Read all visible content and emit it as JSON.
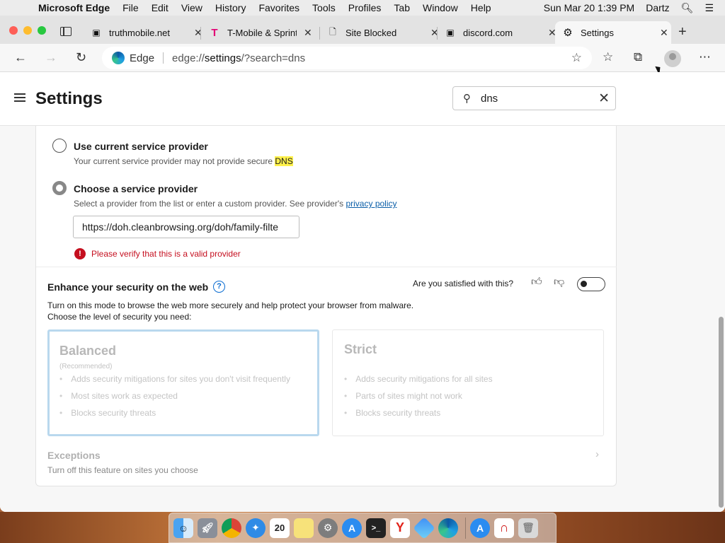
{
  "menubar": {
    "app_name": "Microsoft Edge",
    "items": [
      "File",
      "Edit",
      "View",
      "History",
      "Favorites",
      "Tools",
      "Profiles",
      "Tab",
      "Window",
      "Help"
    ],
    "datetime": "Sun Mar 20  1:39 PM",
    "user": "Dartz"
  },
  "tabs": [
    {
      "title": "truthmobile.net",
      "icon": "page-icon"
    },
    {
      "title": "T-Mobile & Sprint",
      "icon": "tmobile-icon"
    },
    {
      "title": "Site Blocked",
      "icon": "document-icon"
    },
    {
      "title": "discord.com",
      "icon": "page-icon"
    },
    {
      "title": "Settings",
      "icon": "gear-icon"
    }
  ],
  "address": {
    "label": "Edge",
    "url_prefix": "edge://",
    "url_bold": "settings",
    "url_suffix": "/?search=dns"
  },
  "settings": {
    "title": "Settings",
    "search_value": "dns"
  },
  "dns": {
    "option1_label": "Use current service provider",
    "option1_desc_prefix": "Your current service provider may not provide secure ",
    "option1_desc_highlight": "DNS",
    "option2_label": "Choose a service provider",
    "option2_desc": "Select a provider from the list or enter a custom provider. See provider's ",
    "option2_link": "privacy policy",
    "provider_value": "https://doh.cleanbrowsing.org/doh/family-filte",
    "error_text": "Please verify that this is a valid provider"
  },
  "security": {
    "title": "Enhance your security on the web",
    "help_icon": "?",
    "satisfied_text": "Are you satisfied with this?",
    "description": "Turn on this mode to browse the web more securely and help protect your browser from malware. Choose the level of security you need:",
    "balanced": {
      "title": "Balanced",
      "tag": "(Recommended)",
      "items": [
        "Adds security mitigations for sites you don't visit frequently",
        "Most sites work as expected",
        "Blocks security threats"
      ]
    },
    "strict": {
      "title": "Strict",
      "items": [
        "Adds security mitigations for all sites",
        "Parts of sites might not work",
        "Blocks security threats"
      ]
    },
    "exceptions_title": "Exceptions",
    "exceptions_desc": "Turn off this feature on sites you choose"
  },
  "dock": {
    "calendar_day": "20",
    "apps": [
      "finder",
      "launchpad",
      "chrome",
      "safari",
      "calendar",
      "notes",
      "system-preferences",
      "app-store",
      "terminal",
      "yandex",
      "bluestacks",
      "edge",
      "app-store-2",
      "magnet",
      "trash"
    ]
  }
}
